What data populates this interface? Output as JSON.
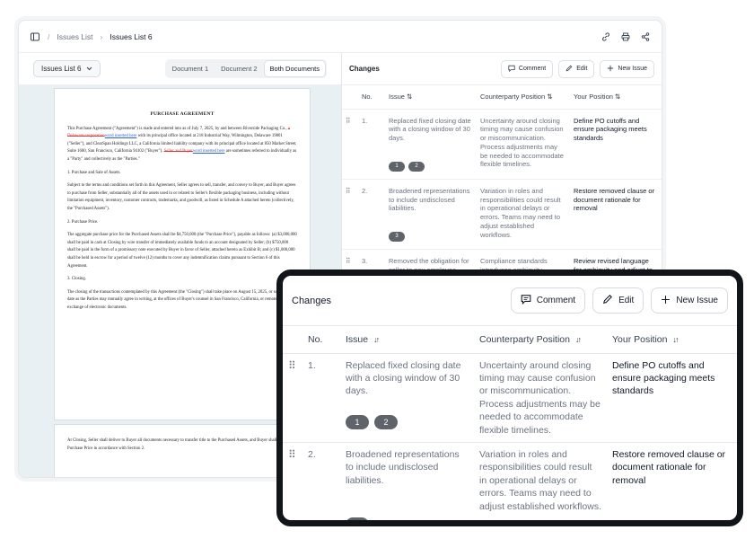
{
  "breadcrumb": {
    "root": "Issues List",
    "current": "Issues List 6"
  },
  "left": {
    "select_label": "Issues List 6",
    "tabs": [
      "Document 1",
      "Document 2",
      "Both Documents"
    ],
    "active_tab": "Both Documents",
    "doc": {
      "title": "PURCHASE AGREEMENT",
      "para1_a": "This Purchase Agreement (\"Agreement\") is made and entered into as of July 7, 2025, by and between Riverside Packaging Co., ",
      "para1_del": "a Delaware corporation",
      "para1_ins": "word inserted here",
      "para1_b": " with its principal office located at 218 Industrial Way, Wilmington, Delaware 19801 (\"Seller\"), and ClearSpan Holdings LLC, a California limited liability company with its principal office located at 850 Market Street, Suite 1600, San Francisco, California 94102 (\"Buyer\"). ",
      "para1_del2": "Seller and Buyer",
      "para1_ins2": "word inserted here",
      "para1_c": " are sometimes referred to individually as a \"Party\" and collectively as the \"Parties.\"",
      "s1": "1. Purchase and Sale of Assets.",
      "s1_text": "Subject to the terms and conditions set forth in this Agreement, Seller agrees to sell, transfer, and convey to Buyer, and Buyer agrees to purchase from Seller, substantially all of the assets used in or related to Seller's flexible packaging business, including without limitation equipment, inventory, customer contracts, trademarks, and goodwill, as listed in Schedule A attached hereto (collectively, the \"Purchased Assets\").",
      "s2": "2. Purchase Price.",
      "s2_text": "The aggregate purchase price for the Purchased Assets shall be $4,750,000 (the \"Purchase Price\"), payable as follows: (a) $3,000,000 shall be paid in cash at Closing by wire transfer of immediately available funds to an account designated by Seller; (b) $750,000 shall be paid in the form of a promissory note executed by Buyer in favor of Seller, attached hereto as Exhibit B; and (c) $1,000,000 shall be held in escrow for a period of twelve (12) months to cover any indemnification claims pursuant to Section 6 of this Agreement.",
      "s3": "3. Closing.",
      "s3_text": "The closing of the transactions contemplated by this Agreement (the \"Closing\") shall take place on August 15, 2025, or such other date as the Parties may mutually agree in writing, at the offices of Buyer's counsel in San Francisco, California, or remotely via the exchange of electronic documents.",
      "p2_text": "At Closing, Seller shall deliver to Buyer all documents necessary to transfer title to the Purchased Assets, and Buyer shall deliver the Purchase Price in accordance with Section 2."
    }
  },
  "changes": {
    "title": "Changes",
    "buttons": {
      "comment": "Comment",
      "edit": "Edit",
      "new_issue": "New Issue"
    },
    "columns": {
      "no": "No.",
      "issue": "Issue",
      "counterparty": "Counterparty Position",
      "your": "Your Position"
    },
    "rows": [
      {
        "no": "1.",
        "issue": "Replaced fixed closing date with a closing window of 30 days.",
        "counterparty": "Uncertainty around closing timing may cause confusion or miscommunication. Process adjustments may be needed to accommodate flexible timelines.",
        "your": "Define PO cutoffs and ensure packaging meets standards",
        "tags": [
          "1",
          "2"
        ]
      },
      {
        "no": "2.",
        "issue": "Broadened representations to include undisclosed liabilities.",
        "counterparty": "Variation in roles and responsibilities could result in operational delays or errors. Teams may need to adjust established workflows.",
        "your": "Restore removed clause or document rationale for removal",
        "tags": [
          "3"
        ]
      },
      {
        "no": "3.",
        "issue": "Removed the obligation for seller to pay employee severance; buyer now responsible.",
        "counterparty": "Compliance standards introduces ambiguity, increasing the likelihood of incorrect assumptions or expectations.",
        "your": "Review revised language for ambiguity and adjust to maintain original intent.",
        "tags": []
      }
    ]
  },
  "colors": {
    "pill": "#5f646b",
    "frame": "#111418",
    "deleted": "#d13b3b",
    "inserted": "#2f62d6",
    "doc_bg": "#e8f0f3"
  }
}
